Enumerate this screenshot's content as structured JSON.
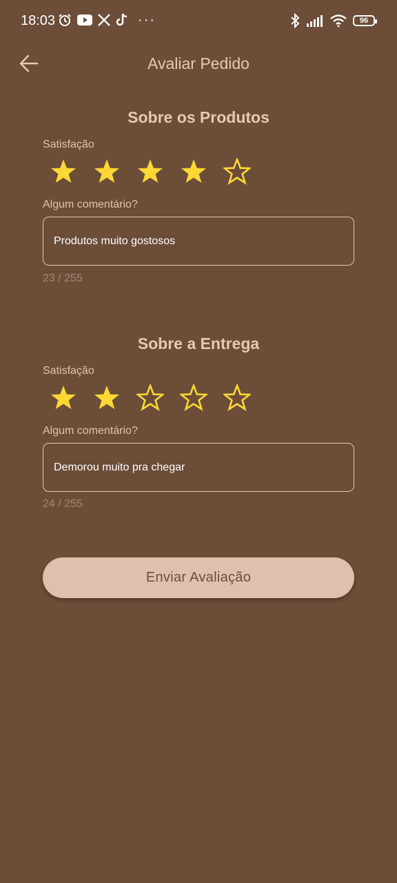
{
  "status_bar": {
    "time": "18:03",
    "battery": "96",
    "left_icons": [
      "alarm-icon",
      "youtube-icon",
      "x-icon",
      "tiktok-icon",
      "more-icon"
    ],
    "right_icons": [
      "bluetooth-icon",
      "signal-icon",
      "wifi-icon",
      "battery-icon"
    ],
    "more": "···"
  },
  "header": {
    "title": "Avaliar Pedido",
    "back_icon": "arrow-back-icon"
  },
  "products": {
    "title": "Sobre os Produtos",
    "satisfaction_label": "Satisfação",
    "rating": 4,
    "max_rating": 5,
    "comment_label": "Algum comentário?",
    "comment": "Produtos muito gostosos",
    "counter": "23 / 255"
  },
  "delivery": {
    "title": "Sobre a Entrega",
    "satisfaction_label": "Satisfação",
    "rating": 2,
    "max_rating": 5,
    "comment_label": "Algum comentário?",
    "comment": "Demorou muito pra chegar",
    "counter": "24 / 255"
  },
  "submit": {
    "label": "Enviar Avaliação"
  },
  "colors": {
    "background": "#6b4d38",
    "accent_text": "#e9c8b3",
    "star": "#fdd835",
    "button": "#dec1ad"
  }
}
